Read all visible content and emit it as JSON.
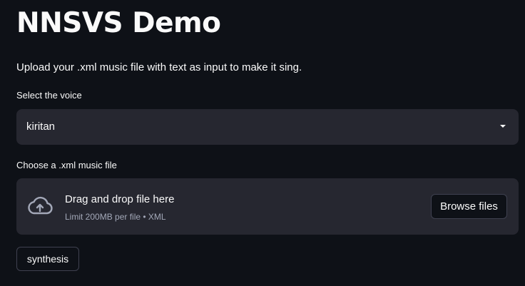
{
  "page": {
    "title": "NNSVS Demo",
    "subtitle": "Upload your .xml music file with text as input to make it sing."
  },
  "voice_select": {
    "label": "Select the voice",
    "value": "kiritan",
    "caret_icon": "chevron-down-icon"
  },
  "file_uploader": {
    "label": "Choose a .xml music file",
    "dropzone_title": "Drag and drop file here",
    "dropzone_hint": "Limit 200MB per file • XML",
    "browse_label": "Browse files",
    "icon": "cloud-upload-icon"
  },
  "actions": {
    "synthesis_label": "synthesis"
  },
  "colors": {
    "background": "#0e1117",
    "widget_background": "#262730",
    "text": "#fafafa",
    "muted_text": "#a3a8b8",
    "border": "#3f4150"
  }
}
